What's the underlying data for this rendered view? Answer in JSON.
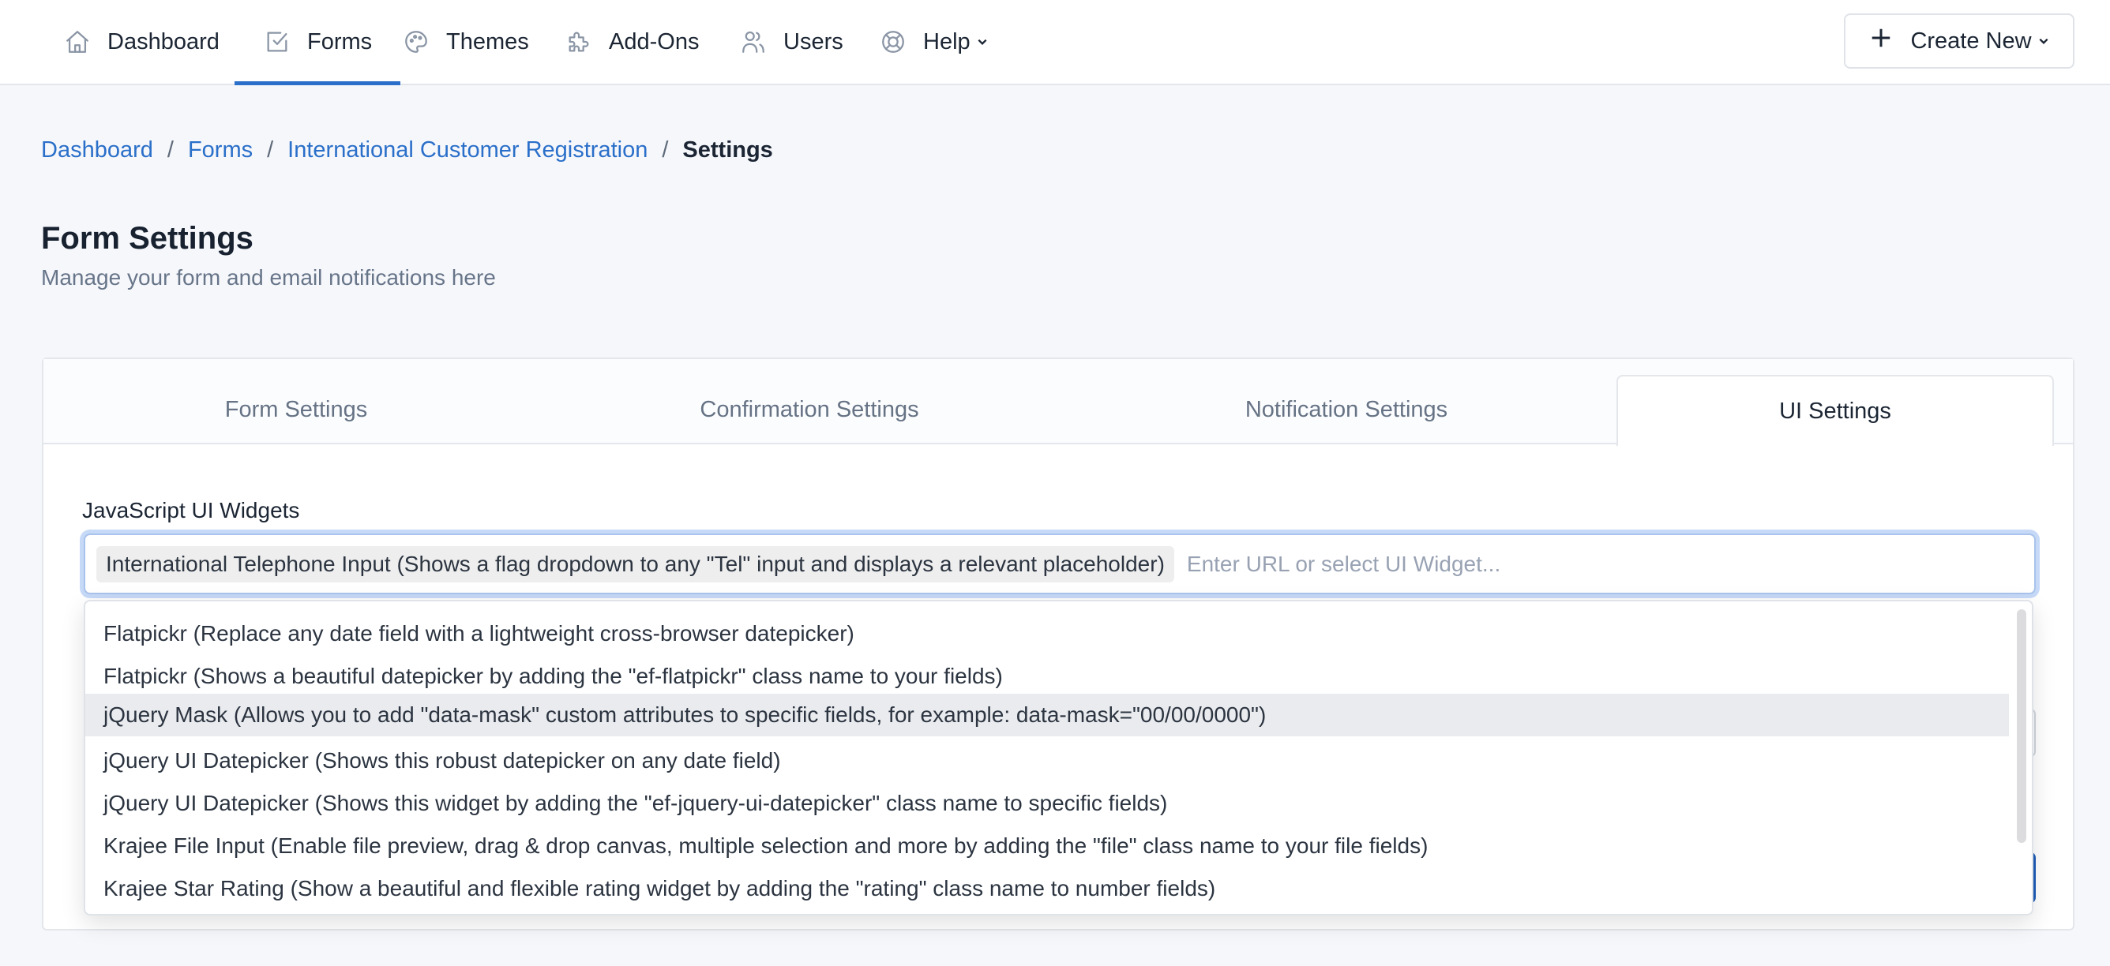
{
  "nav": {
    "items": [
      {
        "label": "Dashboard",
        "icon": "home-icon",
        "active": false
      },
      {
        "label": "Forms",
        "icon": "checkbox-icon",
        "active": true
      },
      {
        "label": "Themes",
        "icon": "palette-icon",
        "active": false
      },
      {
        "label": "Add-Ons",
        "icon": "puzzle-icon",
        "active": false
      },
      {
        "label": "Users",
        "icon": "users-icon",
        "active": false
      },
      {
        "label": "Help",
        "icon": "lifebuoy-icon",
        "active": false,
        "has_dropdown": true
      }
    ],
    "create_new_label": "Create New",
    "accent_color": "#2a6fc9"
  },
  "breadcrumb": {
    "items": [
      "Dashboard",
      "Forms",
      "International Customer Registration"
    ],
    "current": "Settings",
    "separator": "/"
  },
  "page": {
    "title": "Form Settings",
    "subtitle": "Manage your form and email notifications here"
  },
  "tabs": [
    {
      "label": "Form Settings",
      "active": false
    },
    {
      "label": "Confirmation Settings",
      "active": false
    },
    {
      "label": "Notification Settings",
      "active": false
    },
    {
      "label": "UI Settings",
      "active": true
    }
  ],
  "widgets_field": {
    "label": "JavaScript UI Widgets",
    "selected": [
      "International Telephone Input (Shows a flag dropdown to any \"Tel\" input and displays a relevant placeholder)"
    ],
    "placeholder": "Enter URL or select UI Widget...",
    "options": [
      "Flatpickr (Replace any date field with a lightweight cross-browser datepicker)",
      "Flatpickr (Shows a beautiful datepicker by adding the \"ef-flatpickr\" class name to your fields)",
      "jQuery Mask (Allows you to add \"data-mask\" custom attributes to specific fields, for example: data-mask=\"00/00/0000\")",
      "jQuery UI Datepicker (Shows this robust datepicker on any date field)",
      "jQuery UI Datepicker (Shows this widget by adding the \"ef-jquery-ui-datepicker\" class name to specific fields)",
      "Krajee File Input (Enable file preview, drag & drop canvas, multiple selection and more by adding the \"file\" class name to your file fields)",
      "Krajee Star Rating (Show a beautiful and flexible rating widget by adding the \"rating\" class name to number fields)"
    ],
    "highlighted_index": 2
  }
}
